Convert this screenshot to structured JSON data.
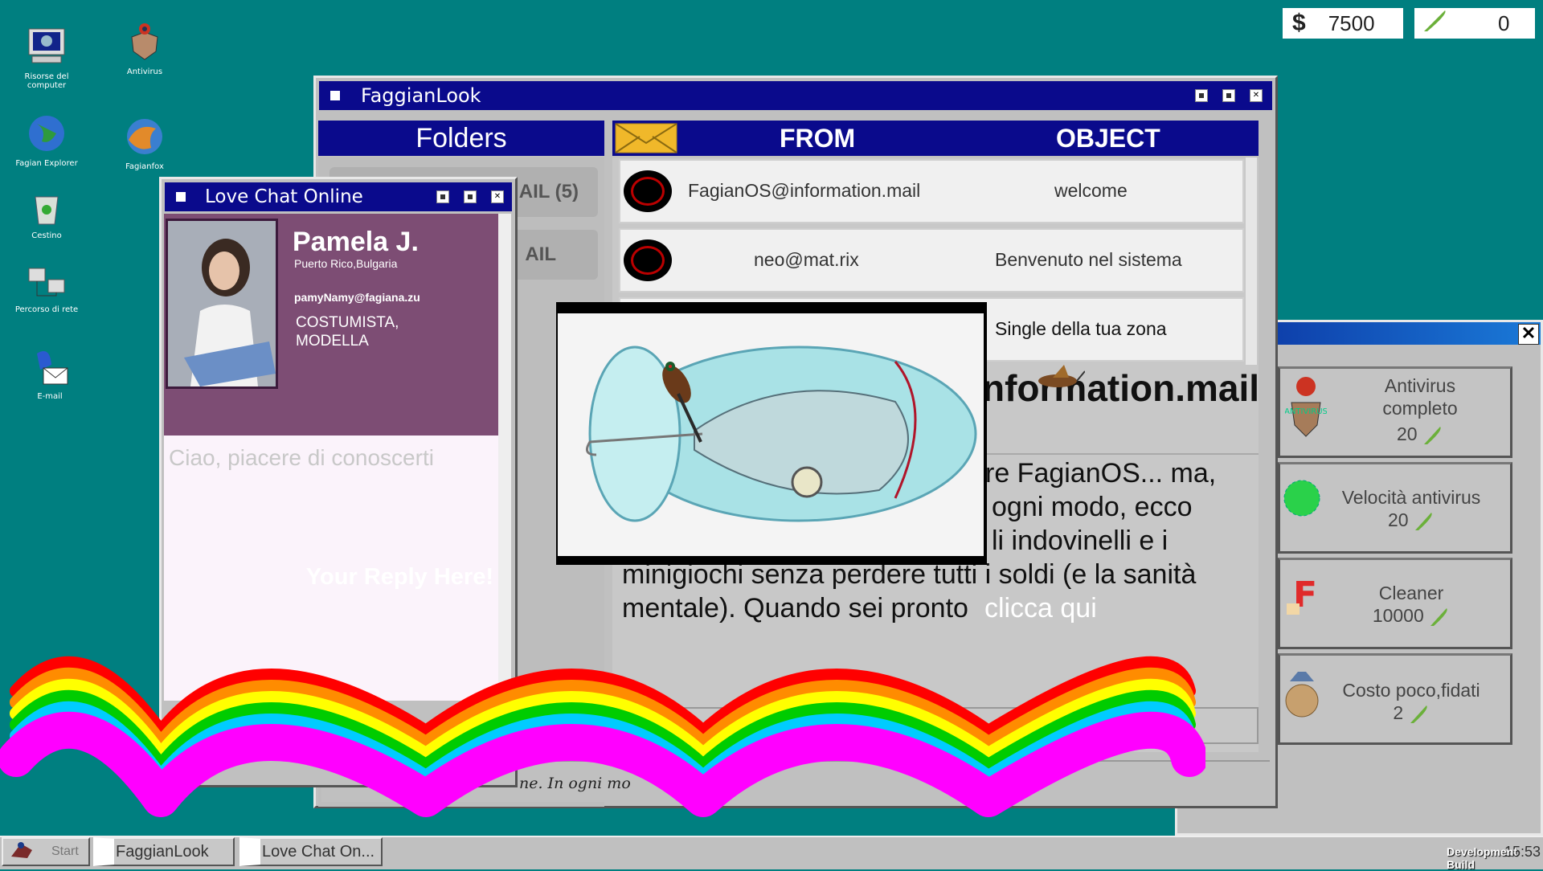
{
  "desktop_icons": [
    {
      "label": "Risorse del computer",
      "icon": "computer-icon"
    },
    {
      "label": "Antivirus",
      "icon": "antivirus-icon"
    },
    {
      "label": "Fagian Explorer",
      "icon": "globe-icon"
    },
    {
      "label": "Fagianfox",
      "icon": "fox-icon"
    },
    {
      "label": "Cestino",
      "icon": "trash-icon"
    },
    {
      "label": "Percorso di rete",
      "icon": "network-icon"
    },
    {
      "label": "E-mail",
      "icon": "email-icon"
    }
  ],
  "stats": {
    "money": "7500",
    "feathers": "0"
  },
  "mail_window": {
    "title": "FaggianLook",
    "folders_header": "Folders",
    "folders": [
      {
        "label": "AIL (5)"
      },
      {
        "label": "AIL"
      }
    ],
    "columns": {
      "from": "FROM",
      "object": "OBJECT"
    },
    "messages": [
      {
        "from": "FagianOS@information.mail",
        "object": "welcome"
      },
      {
        "from": "neo@mat.rix",
        "object": "Benvenuto nel sistema"
      },
      {
        "from": "",
        "object": "Single della tua zona"
      }
    ],
    "preview_sender": "nformation.mail",
    "body_lines": [
      "re FagianOS... ma,",
      "ogni modo, ecco",
      "li indovinelli e i",
      "minigiochi senza perdere tutti i soldi (e la sanità",
      "mentale). Quando sei pronto"
    ],
    "body_link": "clicca qui",
    "reply_snippet": "ne. In ogni mo"
  },
  "chat_window": {
    "title": "Love Chat Online",
    "name": "Pamela J.",
    "location": "Puerto Rico,Bulgaria",
    "email": "pamyNamy@fagiana.zu",
    "job_line1": "COSTUMISTA,",
    "job_line2": "MODELLA",
    "message": "Ciao, piacere di conoscerti",
    "reply_placeholder": "Your Reply Here!"
  },
  "shop": {
    "items": [
      {
        "name_line1": "Antivirus",
        "name_line2": "completo",
        "price": "20",
        "icon": "antivirus-icon"
      },
      {
        "name_line1": "Velocità antivirus",
        "name_line2": "",
        "price": "20",
        "icon": "virus-icon"
      },
      {
        "name_line1": "Cleaner",
        "name_line2": "",
        "price": "10000",
        "icon": "cleaner-icon"
      },
      {
        "name_line1": "Costo poco,fidati",
        "name_line2": "",
        "price": "2",
        "icon": "sack-icon"
      }
    ]
  },
  "taskbar": {
    "start": "Start",
    "items": [
      "FaggianLook",
      "Love Chat On..."
    ],
    "watermark": "Development Build",
    "clock": "15:53"
  },
  "colors": {
    "desktop": "#007f80",
    "titlebar": "#0a0a8c",
    "chat_profile": "#7d4d74",
    "rainbow": [
      "#ff0000",
      "#ff8c00",
      "#ffff00",
      "#00cc00",
      "#00ccff",
      "#0000ff",
      "#ff00ff"
    ]
  }
}
